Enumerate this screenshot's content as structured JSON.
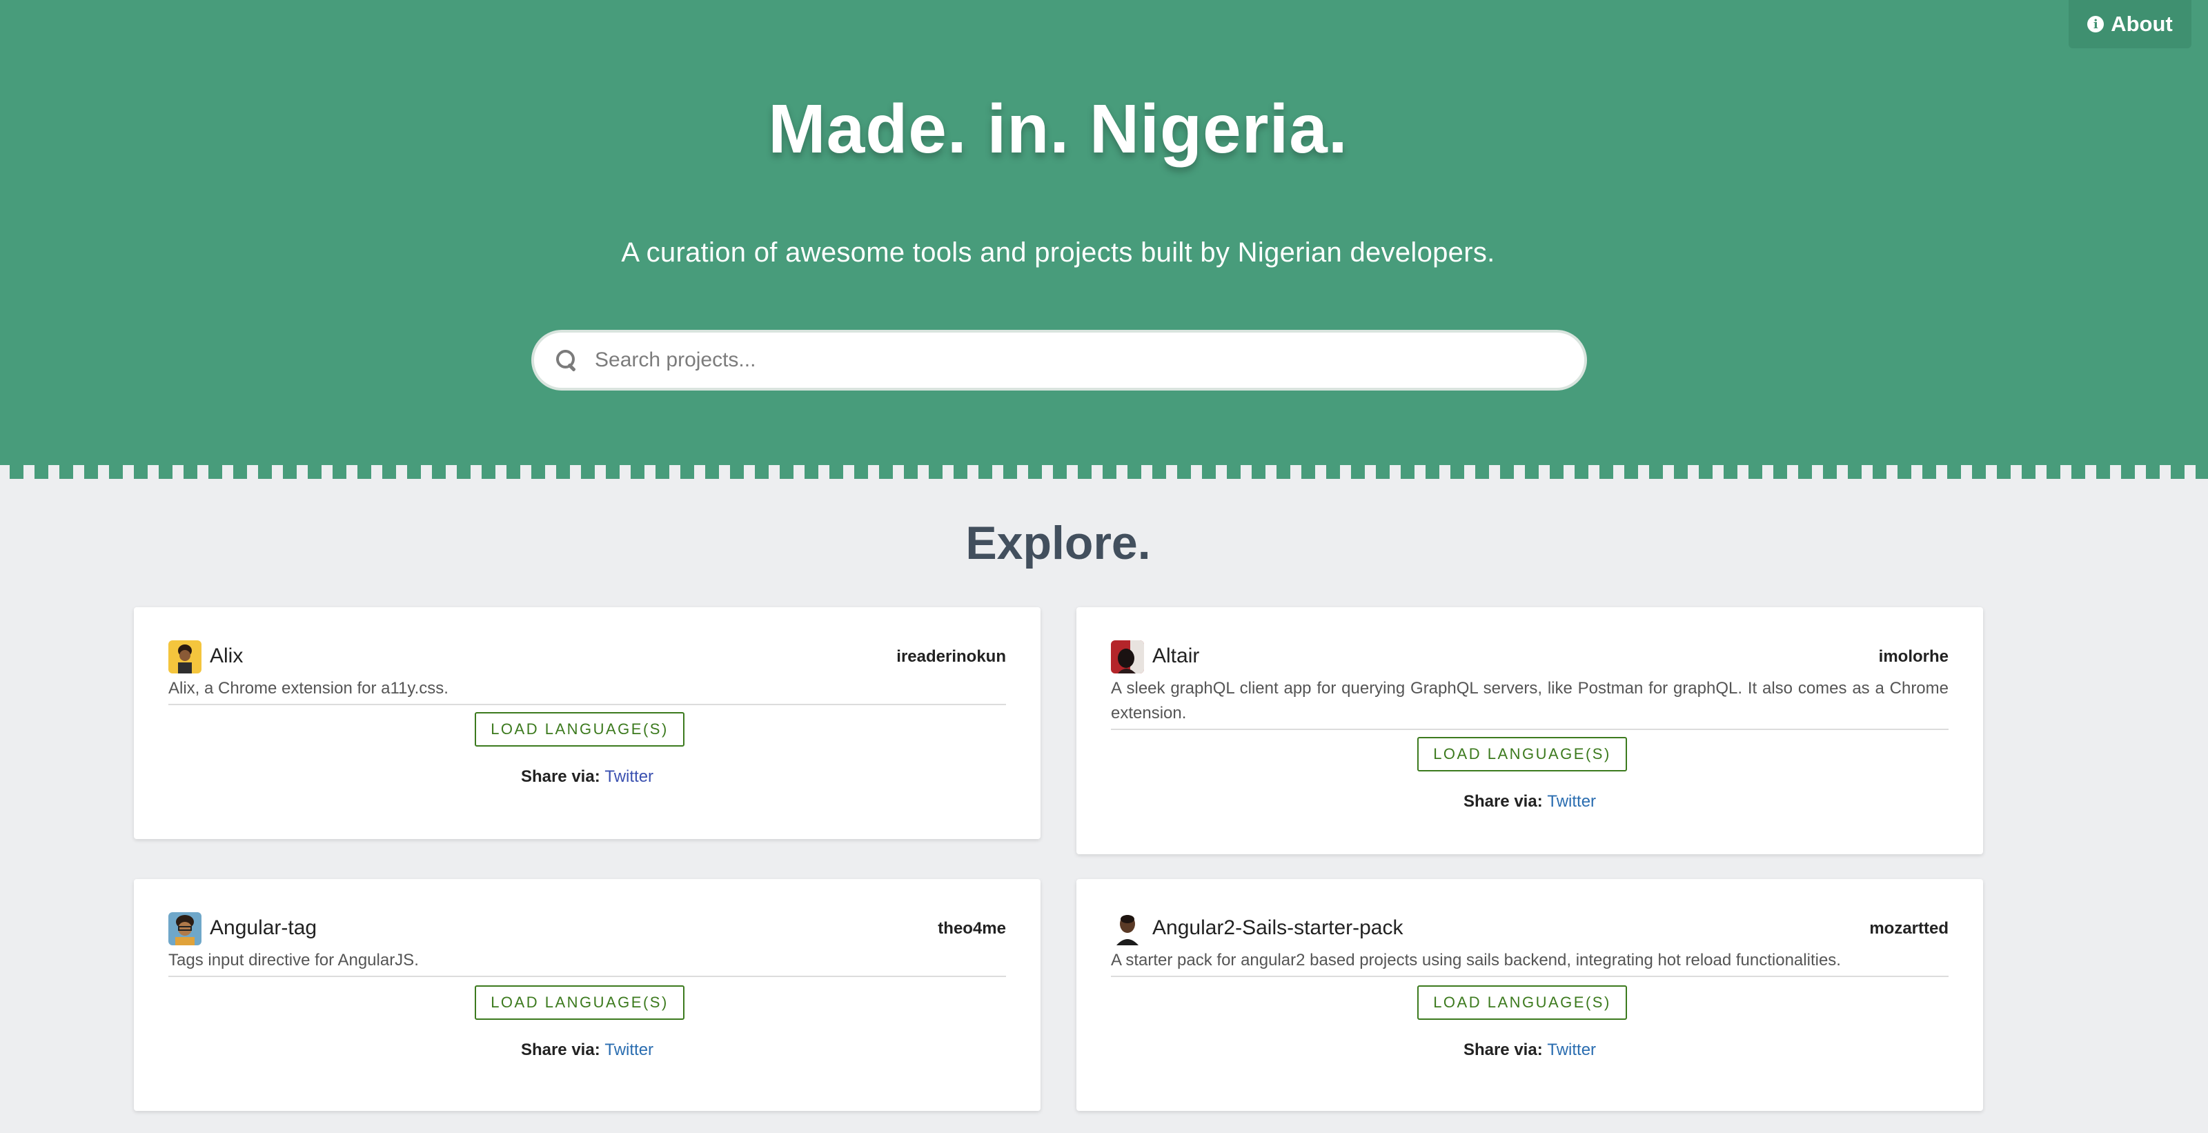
{
  "header": {
    "about_label": "About",
    "title": "Made. in. Nigeria.",
    "subtitle": "A curation of awesome tools and projects built by Nigerian developers.",
    "search_placeholder": "Search projects..."
  },
  "explore": {
    "title": "Explore."
  },
  "projects": [
    {
      "name": "Alix",
      "author": "ireaderinokun",
      "description": "Alix, a Chrome extension for a11y.css.",
      "button": "LOAD LANGUAGE(S)",
      "share_label": "Share via:",
      "share_link": "Twitter"
    },
    {
      "name": "Altair",
      "author": "imolorhe",
      "description": "A sleek graphQL client app for querying GraphQL servers, like Postman for graphQL. It also comes as a Chrome extension.",
      "button": "LOAD LANGUAGE(S)",
      "share_label": "Share via:",
      "share_link": "Twitter"
    },
    {
      "name": "Angular-tag",
      "author": "theo4me",
      "description": "Tags input directive for AngularJS.",
      "button": "LOAD LANGUAGE(S)",
      "share_label": "Share via:",
      "share_link": "Twitter"
    },
    {
      "name": "Angular2-Sails-starter-pack",
      "author": "mozartted",
      "description": "A starter pack for angular2 based projects using sails backend, integrating hot reload functionalities.",
      "button": "LOAD LANGUAGE(S)",
      "share_label": "Share via:",
      "share_link": "Twitter"
    }
  ],
  "colors": {
    "hero": "#489c7b",
    "button_green": "#3c7a1e",
    "link": "#2a6db0",
    "heading": "#424f5d"
  }
}
